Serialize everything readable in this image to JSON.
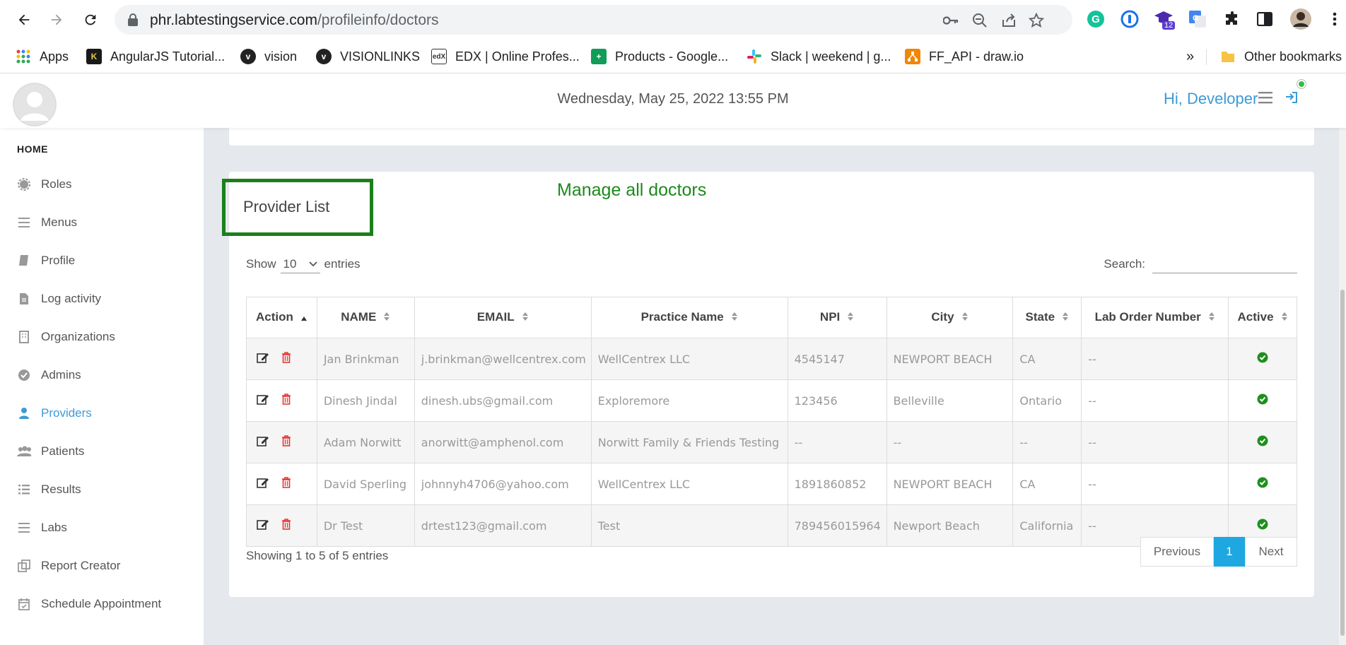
{
  "browser": {
    "url_host": "phr.labtestingservice.com",
    "url_path": "/profileinfo/doctors",
    "extension_badge": "12",
    "bookmarks": [
      {
        "label": "Apps",
        "icon": "apps-grid-icon"
      },
      {
        "label": "AngularJS Tutorial...",
        "icon": "angular-tutorial-icon"
      },
      {
        "label": "vision",
        "icon": "vision-icon"
      },
      {
        "label": "VISIONLINKS",
        "icon": "visionlinks-icon"
      },
      {
        "label": "EDX | Online Profes...",
        "icon": "edx-icon"
      },
      {
        "label": "Products - Google...",
        "icon": "google-sheets-icon"
      },
      {
        "label": "Slack | weekend | g...",
        "icon": "slack-icon"
      },
      {
        "label": "FF_API - draw.io",
        "icon": "drawio-icon"
      }
    ],
    "overflow_label": "»",
    "other_bookmarks": "Other bookmarks"
  },
  "header": {
    "datetime": "Wednesday, May 25, 2022 13:55 PM",
    "greeting": "Hi, Developer"
  },
  "sidebar": {
    "home_label": "HOME",
    "items": [
      {
        "label": "Roles",
        "icon": "gear-icon"
      },
      {
        "label": "Menus",
        "icon": "menu-icon"
      },
      {
        "label": "Profile",
        "icon": "book-icon"
      },
      {
        "label": "Log activity",
        "icon": "file-icon"
      },
      {
        "label": "Organizations",
        "icon": "building-icon"
      },
      {
        "label": "Admins",
        "icon": "check-circle-icon"
      },
      {
        "label": "Providers",
        "icon": "user-md-icon",
        "active": true
      },
      {
        "label": "Patients",
        "icon": "users-icon"
      },
      {
        "label": "Results",
        "icon": "list-icon"
      },
      {
        "label": "Labs",
        "icon": "lines-icon"
      },
      {
        "label": "Report Creator",
        "icon": "clone-icon"
      },
      {
        "label": "Schedule Appointment",
        "icon": "calendar-check-icon"
      }
    ]
  },
  "card": {
    "title": "Provider List",
    "annotation": "Manage all doctors",
    "show_label": "Show",
    "entries_value": "10",
    "entries_label": "entries",
    "search_label": "Search:",
    "search_value": "",
    "columns": [
      "Action",
      "NAME",
      "EMAIL",
      "Practice Name",
      "NPI",
      "City",
      "State",
      "Lab Order Number",
      "Active"
    ],
    "rows": [
      {
        "name": "Jan Brinkman",
        "email": "j.brinkman@wellcentrex.com",
        "practice": "WellCentrex LLC",
        "npi": "4545147",
        "city": "NEWPORT BEACH",
        "state": "CA",
        "lab_order": "--",
        "active": true
      },
      {
        "name": "Dinesh Jindal",
        "email": "dinesh.ubs@gmail.com",
        "practice": "Exploremore",
        "npi": "123456",
        "city": "Belleville",
        "state": "Ontario",
        "lab_order": "--",
        "active": true
      },
      {
        "name": "Adam Norwitt",
        "email": "anorwitt@amphenol.com",
        "practice": "Norwitt Family & Friends Testing",
        "npi": "--",
        "city": "--",
        "state": "--",
        "lab_order": "--",
        "active": true
      },
      {
        "name": "David Sperling",
        "email": "johnnyh4706@yahoo.com",
        "practice": "WellCentrex LLC",
        "npi": "1891860852",
        "city": "NEWPORT BEACH",
        "state": "CA",
        "lab_order": "--",
        "active": true
      },
      {
        "name": "Dr Test",
        "email": "drtest123@gmail.com",
        "practice": "Test",
        "npi": "789456015964",
        "city": "Newport Beach",
        "state": "California",
        "lab_order": "--",
        "active": true
      }
    ],
    "showing": "Showing 1 to 5 of 5 entries",
    "pager": {
      "previous": "Previous",
      "current": "1",
      "next": "Next"
    }
  },
  "colors": {
    "accent": "#3d9ad6",
    "annotation_green": "#1b8a1b",
    "delete_red": "#e53935",
    "active_green": "#1e8f1e",
    "pager_active": "#1ea7e1"
  }
}
